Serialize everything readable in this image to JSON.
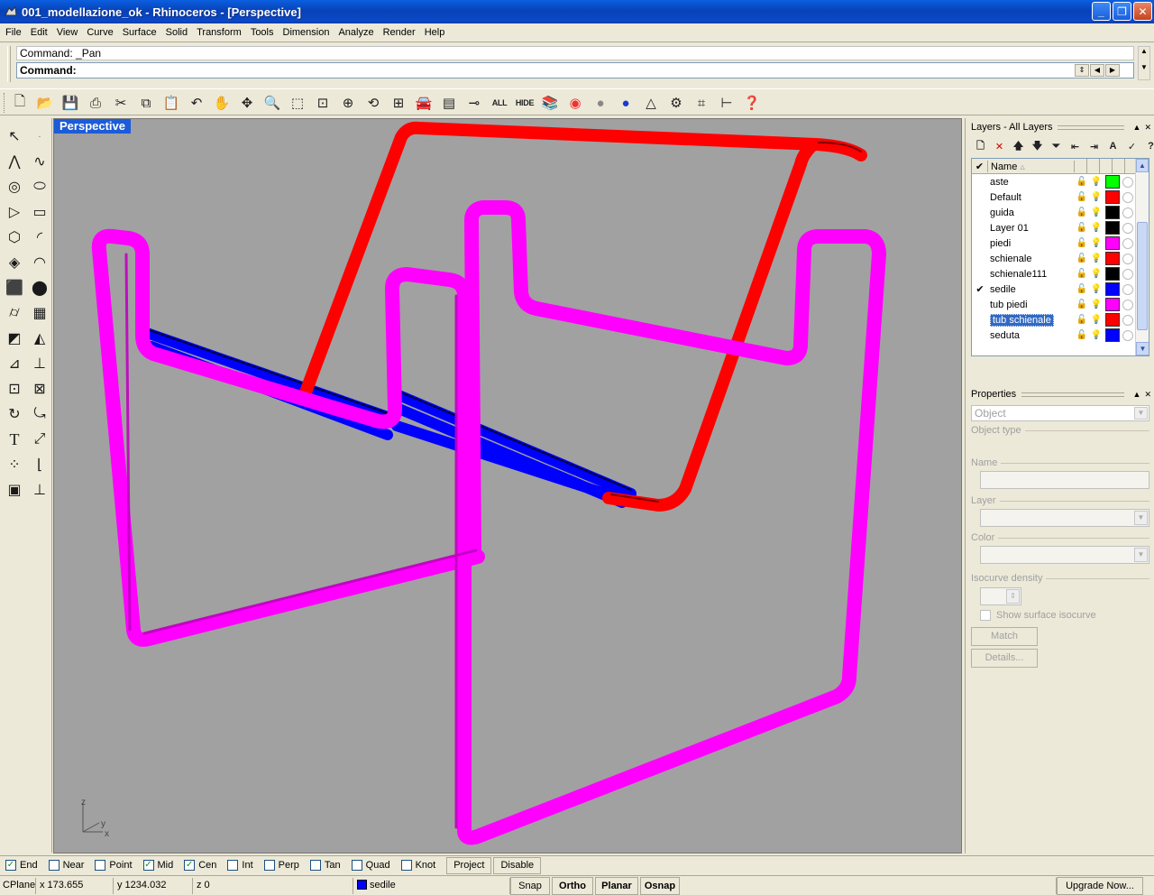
{
  "window": {
    "title": "001_modellazione_ok - Rhinoceros - [Perspective]",
    "buttons": {
      "minimize": "_",
      "maximize": "❐",
      "close": "✕"
    }
  },
  "menu": [
    "File",
    "Edit",
    "View",
    "Curve",
    "Surface",
    "Solid",
    "Transform",
    "Tools",
    "Dimension",
    "Analyze",
    "Render",
    "Help"
  ],
  "command": {
    "history": "Command: _Pan",
    "prompt": "Command:"
  },
  "toolbar": {
    "all_label": "ALL",
    "hide_label": "HIDE"
  },
  "viewport": {
    "label": "Perspective",
    "axis": {
      "z": "z",
      "y": "y",
      "x": "x"
    }
  },
  "layers_panel": {
    "title": "Layers - All Layers",
    "header_name": "Name",
    "layers": [
      {
        "name": "aste",
        "current": false,
        "selected": false,
        "bulb_on": false,
        "color": "#00ff00"
      },
      {
        "name": "Default",
        "current": false,
        "selected": false,
        "bulb_on": false,
        "color": "#ff0000"
      },
      {
        "name": "guida",
        "current": false,
        "selected": false,
        "bulb_on": false,
        "color": "#000000"
      },
      {
        "name": "Layer 01",
        "current": false,
        "selected": false,
        "bulb_on": true,
        "color": "#000000"
      },
      {
        "name": "piedi",
        "current": false,
        "selected": false,
        "bulb_on": false,
        "color": "#ff00ff"
      },
      {
        "name": "schienale",
        "current": false,
        "selected": false,
        "bulb_on": false,
        "color": "#ff0000"
      },
      {
        "name": "schienale111",
        "current": false,
        "selected": false,
        "bulb_on": false,
        "color": "#000000"
      },
      {
        "name": "sedile",
        "current": true,
        "selected": false,
        "bulb_on": false,
        "color": "#0000ff"
      },
      {
        "name": "tub piedi",
        "current": false,
        "selected": false,
        "bulb_on": true,
        "color": "#ff00ff"
      },
      {
        "name": "tub schienale",
        "current": false,
        "selected": true,
        "bulb_on": true,
        "color": "#ff0000"
      },
      {
        "name": "seduta",
        "current": false,
        "selected": false,
        "bulb_on": false,
        "color": "#0000ff"
      }
    ]
  },
  "properties_panel": {
    "title": "Properties",
    "object_combo": "Object",
    "object_type_label": "Object type",
    "name_label": "Name",
    "layer_label": "Layer",
    "color_label": "Color",
    "isocurve_label": "Isocurve density",
    "show_isocurve_label": "Show surface isocurve",
    "match_label": "Match",
    "details_label": "Details..."
  },
  "osnap": {
    "items": [
      {
        "label": "End",
        "checked": true
      },
      {
        "label": "Near",
        "checked": false
      },
      {
        "label": "Point",
        "checked": false
      },
      {
        "label": "Mid",
        "checked": true
      },
      {
        "label": "Cen",
        "checked": true
      },
      {
        "label": "Int",
        "checked": false
      },
      {
        "label": "Perp",
        "checked": false
      },
      {
        "label": "Tan",
        "checked": false
      },
      {
        "label": "Quad",
        "checked": false
      },
      {
        "label": "Knot",
        "checked": false
      }
    ],
    "project_label": "Project",
    "disable_label": "Disable"
  },
  "status": {
    "cplane": "CPlane",
    "x": "x 173.655",
    "y": "y 1234.032",
    "z": "z 0",
    "layer": "sedile",
    "snap": "Snap",
    "ortho": "Ortho",
    "planar": "Planar",
    "osnap": "Osnap",
    "upgrade": "Upgrade Now..."
  },
  "colors": {
    "magenta": "#ff00ff",
    "red": "#ff0000",
    "blue": "#0000ff",
    "viewport_bg": "#a1a1a1",
    "title_blue": "#0842b8"
  }
}
